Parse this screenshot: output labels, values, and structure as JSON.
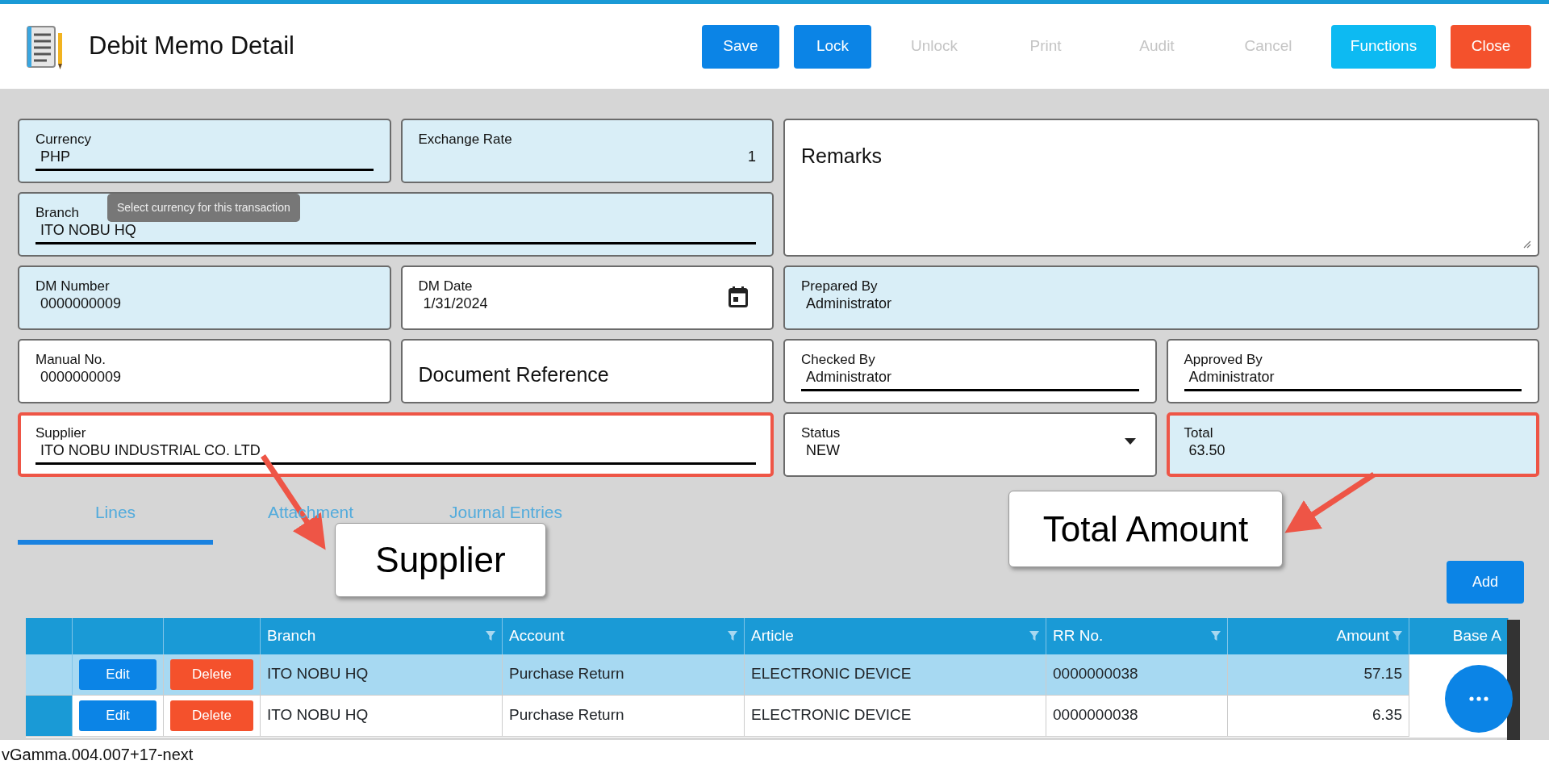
{
  "header": {
    "title": "Debit Memo Detail",
    "buttons": [
      {
        "label": "Save",
        "kind": "primary",
        "disabled": false
      },
      {
        "label": "Lock",
        "kind": "primary",
        "disabled": false
      },
      {
        "label": "Unlock",
        "kind": "primary",
        "disabled": true
      },
      {
        "label": "Print",
        "kind": "primary",
        "disabled": true
      },
      {
        "label": "Audit",
        "kind": "primary",
        "disabled": true
      },
      {
        "label": "Cancel",
        "kind": "primary",
        "disabled": true
      },
      {
        "label": "Functions",
        "kind": "info",
        "disabled": false
      },
      {
        "label": "Close",
        "kind": "danger",
        "disabled": false
      }
    ]
  },
  "form": {
    "fields": [
      {
        "kind": "input",
        "label": "Currency",
        "value": "PHP",
        "readonly": true,
        "underline": true,
        "highlighted": false
      },
      {
        "kind": "number",
        "label": "Exchange Rate",
        "value": "1",
        "readonly": true,
        "underline": false,
        "highlighted": false
      },
      {
        "kind": "textarea",
        "placeholder": "Remarks",
        "readonly": false,
        "highlighted": false
      },
      {
        "kind": "input",
        "label": "Branch",
        "value": "ITO NOBU HQ",
        "readonly": true,
        "underline": true,
        "highlighted": false
      },
      {
        "kind": "input",
        "label": "DM Number",
        "value": "0000000009",
        "readonly": true,
        "underline": false,
        "highlighted": false
      },
      {
        "kind": "date",
        "label": "DM Date",
        "value": "1/31/2024",
        "readonly": false,
        "underline": false,
        "highlighted": false
      },
      {
        "kind": "input",
        "label": "Prepared By",
        "value": "Administrator",
        "readonly": true,
        "underline": false,
        "highlighted": false
      },
      {
        "kind": "input",
        "label": "Manual No.",
        "value": "0000000009",
        "readonly": false,
        "underline": false,
        "highlighted": false
      },
      {
        "kind": "empty",
        "placeholder": "Document Reference",
        "readonly": false,
        "highlighted": false
      },
      {
        "kind": "input",
        "label": "Checked By",
        "value": "Administrator",
        "readonly": false,
        "underline": true,
        "highlighted": false
      },
      {
        "kind": "input",
        "label": "Approved By",
        "value": "Administrator",
        "readonly": false,
        "underline": true,
        "highlighted": false
      },
      {
        "kind": "input",
        "label": "Supplier",
        "value": "ITO NOBU INDUSTRIAL CO. LTD",
        "readonly": false,
        "underline": true,
        "highlighted": true
      },
      {
        "kind": "select",
        "label": "Status",
        "value": "NEW",
        "readonly": false,
        "underline": false,
        "highlighted": false
      },
      {
        "kind": "input",
        "label": "Total",
        "value": "63.50",
        "readonly": true,
        "underline": false,
        "highlighted": true
      }
    ],
    "tooltip": "Select currency for this transaction"
  },
  "tabs": [
    {
      "label": "Lines",
      "selected": true
    },
    {
      "label": "Attachment",
      "selected": false
    },
    {
      "label": "Journal Entries",
      "selected": false
    }
  ],
  "callouts": [
    {
      "text": "Supplier"
    },
    {
      "text": "Total Amount"
    }
  ],
  "add_button": "Add",
  "table": {
    "columns": [
      "Branch",
      "Account",
      "Article",
      "RR No.",
      "Amount",
      "Base A"
    ],
    "rows": [
      {
        "selected": true,
        "edit": "Edit",
        "delete": "Delete",
        "cells": [
          "ITO NOBU HQ",
          "Purchase Return",
          "ELECTRONIC DEVICE",
          "0000000038",
          "57.15"
        ]
      },
      {
        "selected": false,
        "edit": "Edit",
        "delete": "Delete",
        "cells": [
          "ITO NOBU HQ",
          "Purchase Return",
          "ELECTRONIC DEVICE",
          "0000000038",
          "6.35"
        ]
      }
    ]
  },
  "status_bar": "vGamma.004.007+17-next"
}
